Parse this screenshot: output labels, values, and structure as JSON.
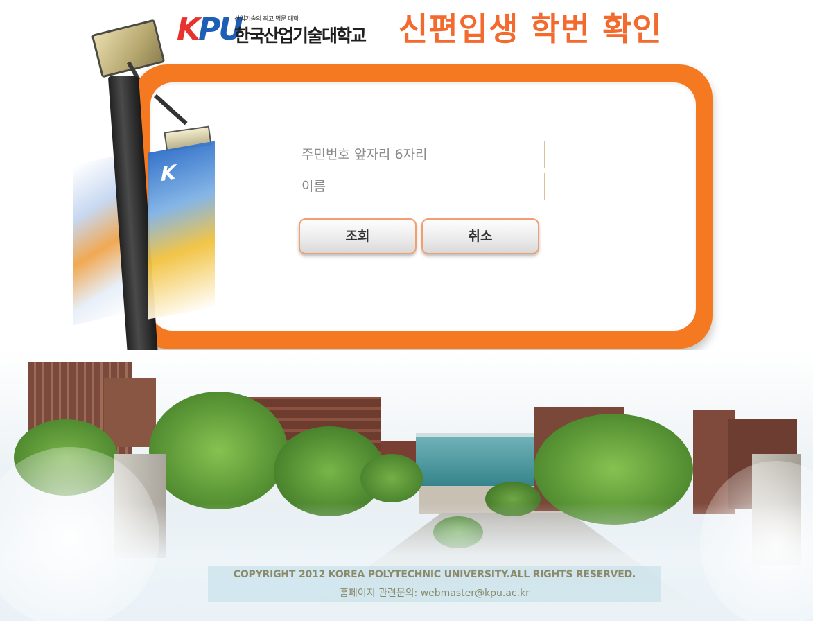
{
  "header": {
    "logo_mark": {
      "k": "K",
      "p": "P",
      "u": "U"
    },
    "logo_tagline": "산업기술의 최고 명문 대학",
    "logo_name": "한국산업기술대학교",
    "title": "신편입생 학번 확인"
  },
  "form": {
    "birth_placeholder": "주민번호 앞자리 6자리",
    "name_placeholder": "이름",
    "search_button": "조회",
    "cancel_button": "취소"
  },
  "banner": {
    "text": "K"
  },
  "footer": {
    "copyright": "COPYRIGHT 2012 KOREA POLYTECHNIC UNIVERSITY.ALL RIGHTS RESERVED.",
    "contact": "홈페이지 관련문의: webmaster@kpu.ac.kr"
  },
  "colors": {
    "accent_orange": "#f47920",
    "title_orange": "#f26a2d",
    "logo_red": "#e8322d",
    "logo_blue": "#1d5fb4"
  }
}
